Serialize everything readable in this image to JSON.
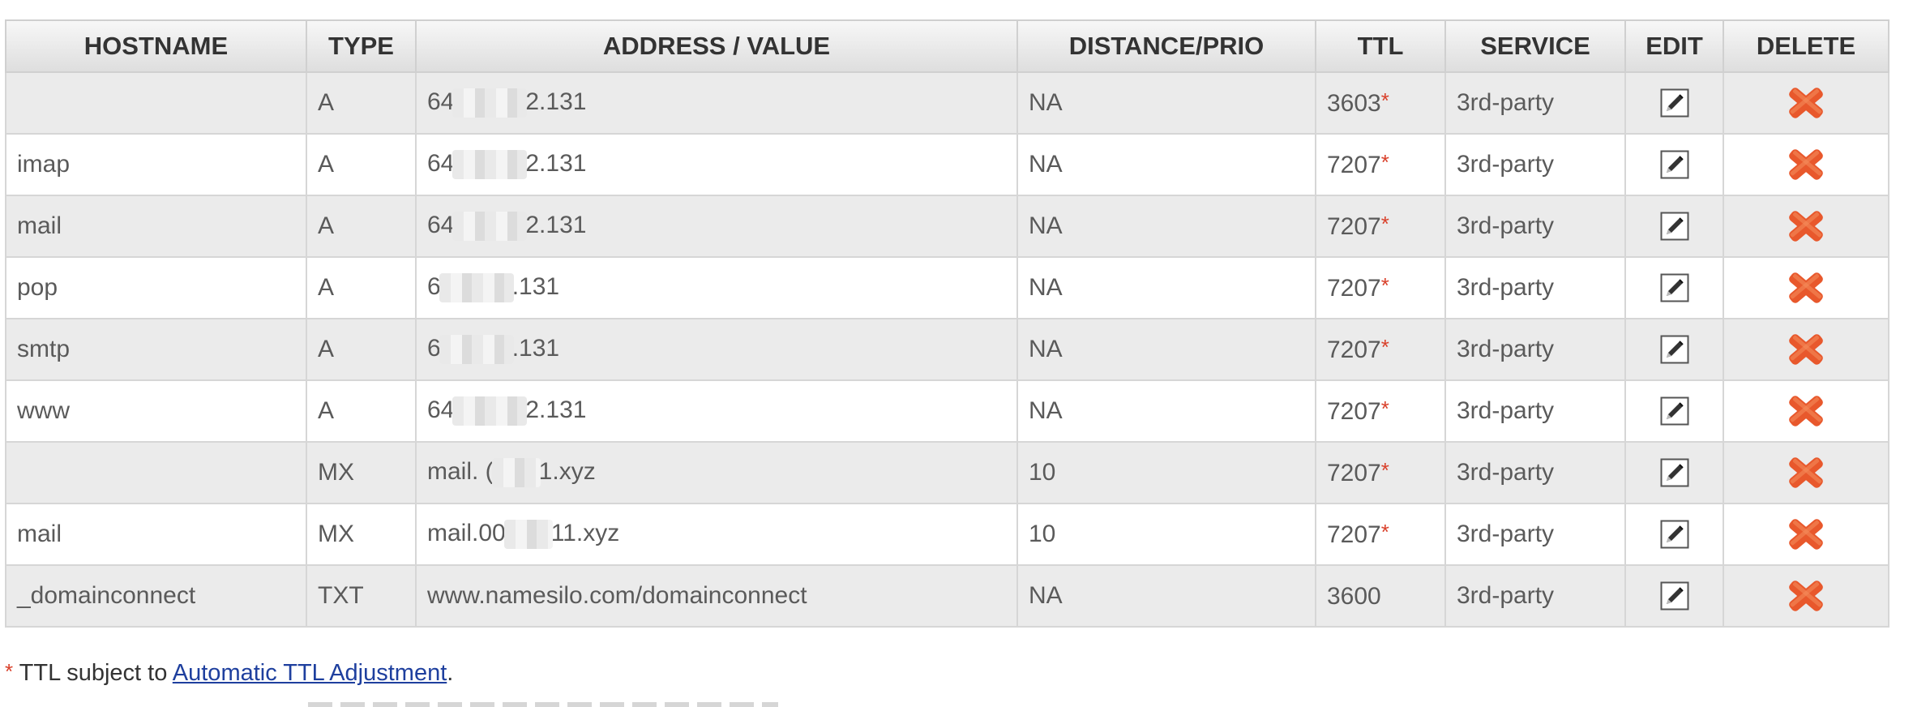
{
  "table": {
    "headers": {
      "hostname": "HOSTNAME",
      "type": "TYPE",
      "address": "ADDRESS / VALUE",
      "distance": "DISTANCE/PRIO",
      "ttl": "TTL",
      "service": "SERVICE",
      "edit": "EDIT",
      "delete": "DELETE"
    },
    "rows": [
      {
        "hostname": "",
        "type": "A",
        "addr_pre": "64",
        "addr_post": "2.131",
        "distance": "NA",
        "ttl": "3603",
        "ttl_star": "*",
        "service": "3rd-party"
      },
      {
        "hostname": "imap",
        "type": "A",
        "addr_pre": "64",
        "addr_post": "2.131",
        "distance": "NA",
        "ttl": "7207",
        "ttl_star": "*",
        "service": "3rd-party"
      },
      {
        "hostname": "mail",
        "type": "A",
        "addr_pre": "64",
        "addr_post": "2.131",
        "distance": "NA",
        "ttl": "7207",
        "ttl_star": "*",
        "service": "3rd-party"
      },
      {
        "hostname": "pop",
        "type": "A",
        "addr_pre": "6",
        "addr_post": ".131",
        "distance": "NA",
        "ttl": "7207",
        "ttl_star": "*",
        "service": "3rd-party"
      },
      {
        "hostname": "smtp",
        "type": "A",
        "addr_pre": "6",
        "addr_post": ".131",
        "distance": "NA",
        "ttl": "7207",
        "ttl_star": "*",
        "service": "3rd-party"
      },
      {
        "hostname": "www",
        "type": "A",
        "addr_pre": "64",
        "addr_post": "2.131",
        "distance": "NA",
        "ttl": "7207",
        "ttl_star": "*",
        "service": "3rd-party"
      },
      {
        "hostname": "",
        "type": "MX",
        "addr_pre": "mail. (",
        "addr_post": "1.xyz",
        "distance": "10",
        "ttl": "7207",
        "ttl_star": "*",
        "service": "3rd-party"
      },
      {
        "hostname": "mail",
        "type": "MX",
        "addr_pre": "mail.00",
        "addr_post": "11.xyz",
        "distance": "10",
        "ttl": "7207",
        "ttl_star": "*",
        "service": "3rd-party"
      },
      {
        "hostname": "_domainconnect",
        "type": "TXT",
        "addr_pre": "www.namesilo.com/domainconnect",
        "addr_post": "",
        "distance": "NA",
        "ttl": "3600",
        "ttl_star": "",
        "service": "3rd-party"
      }
    ]
  },
  "footnote": {
    "star": "*",
    "text": " TTL subject to ",
    "link": "Automatic TTL Adjustment",
    "end": "."
  },
  "icons": {
    "edit": "edit-pencil-icon",
    "delete": "delete-x-icon"
  },
  "colors": {
    "star": "#d9402a",
    "delete": "#e8582c",
    "link": "#1e3f9e",
    "row_alt": "#ebebeb"
  }
}
